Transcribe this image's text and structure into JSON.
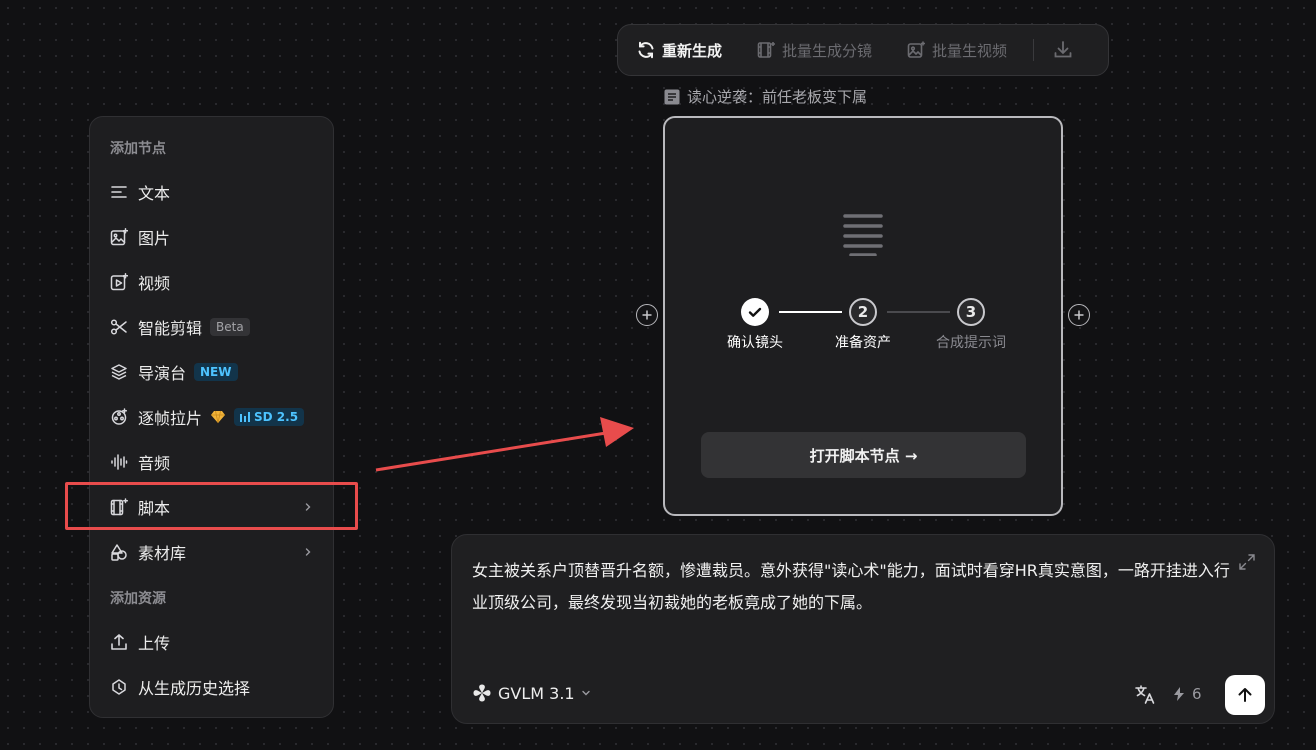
{
  "toolbar": {
    "regenerate": "重新生成",
    "batch_storyboard": "批量生成分镜",
    "batch_video": "批量生视频"
  },
  "node": {
    "title": "读心逆袭：前任老板变下属",
    "steps": [
      {
        "label": "确认镜头",
        "status": "done"
      },
      {
        "number": "2",
        "label": "准备资产",
        "status": "current"
      },
      {
        "number": "3",
        "label": "合成提示词",
        "status": "pending"
      }
    ],
    "open_button": "打开脚本节点 →"
  },
  "menu": {
    "section_add_node": "添加节点",
    "items": [
      {
        "label": "文本",
        "icon": "text-lines-icon"
      },
      {
        "label": "图片",
        "icon": "image-sparkle-icon"
      },
      {
        "label": "视频",
        "icon": "video-sparkle-icon"
      },
      {
        "label": "智能剪辑",
        "icon": "scissors-icon",
        "badge": "Beta"
      },
      {
        "label": "导演台",
        "icon": "layers-icon",
        "badge": "NEW"
      },
      {
        "label": "逐帧拉片",
        "icon": "film-reel-icon",
        "badge": "SD 2.5"
      },
      {
        "label": "音频",
        "icon": "audio-wave-icon"
      },
      {
        "label": "脚本",
        "icon": "script-icon",
        "has_submenu": true
      },
      {
        "label": "素材库",
        "icon": "assets-icon",
        "has_submenu": true
      }
    ],
    "section_add_resource": "添加资源",
    "resources": [
      {
        "label": "上传",
        "icon": "upload-icon"
      },
      {
        "label": "从生成历史选择",
        "icon": "history-icon"
      }
    ]
  },
  "prompt": {
    "text": "女主被关系户顶替晋升名额，惨遭裁员。意外获得\"读心术\"能力，面试时看穿HR真实意图，一路开挂进入行业顶级公司，最终发现当初裁她的老板竟成了她的下属。",
    "model": "GVLM 3.1",
    "credits": "6"
  },
  "colors": {
    "highlight": "#e84c4c",
    "badge_blue": "#4dc3ff",
    "badge_gold": "#f2b43a"
  }
}
